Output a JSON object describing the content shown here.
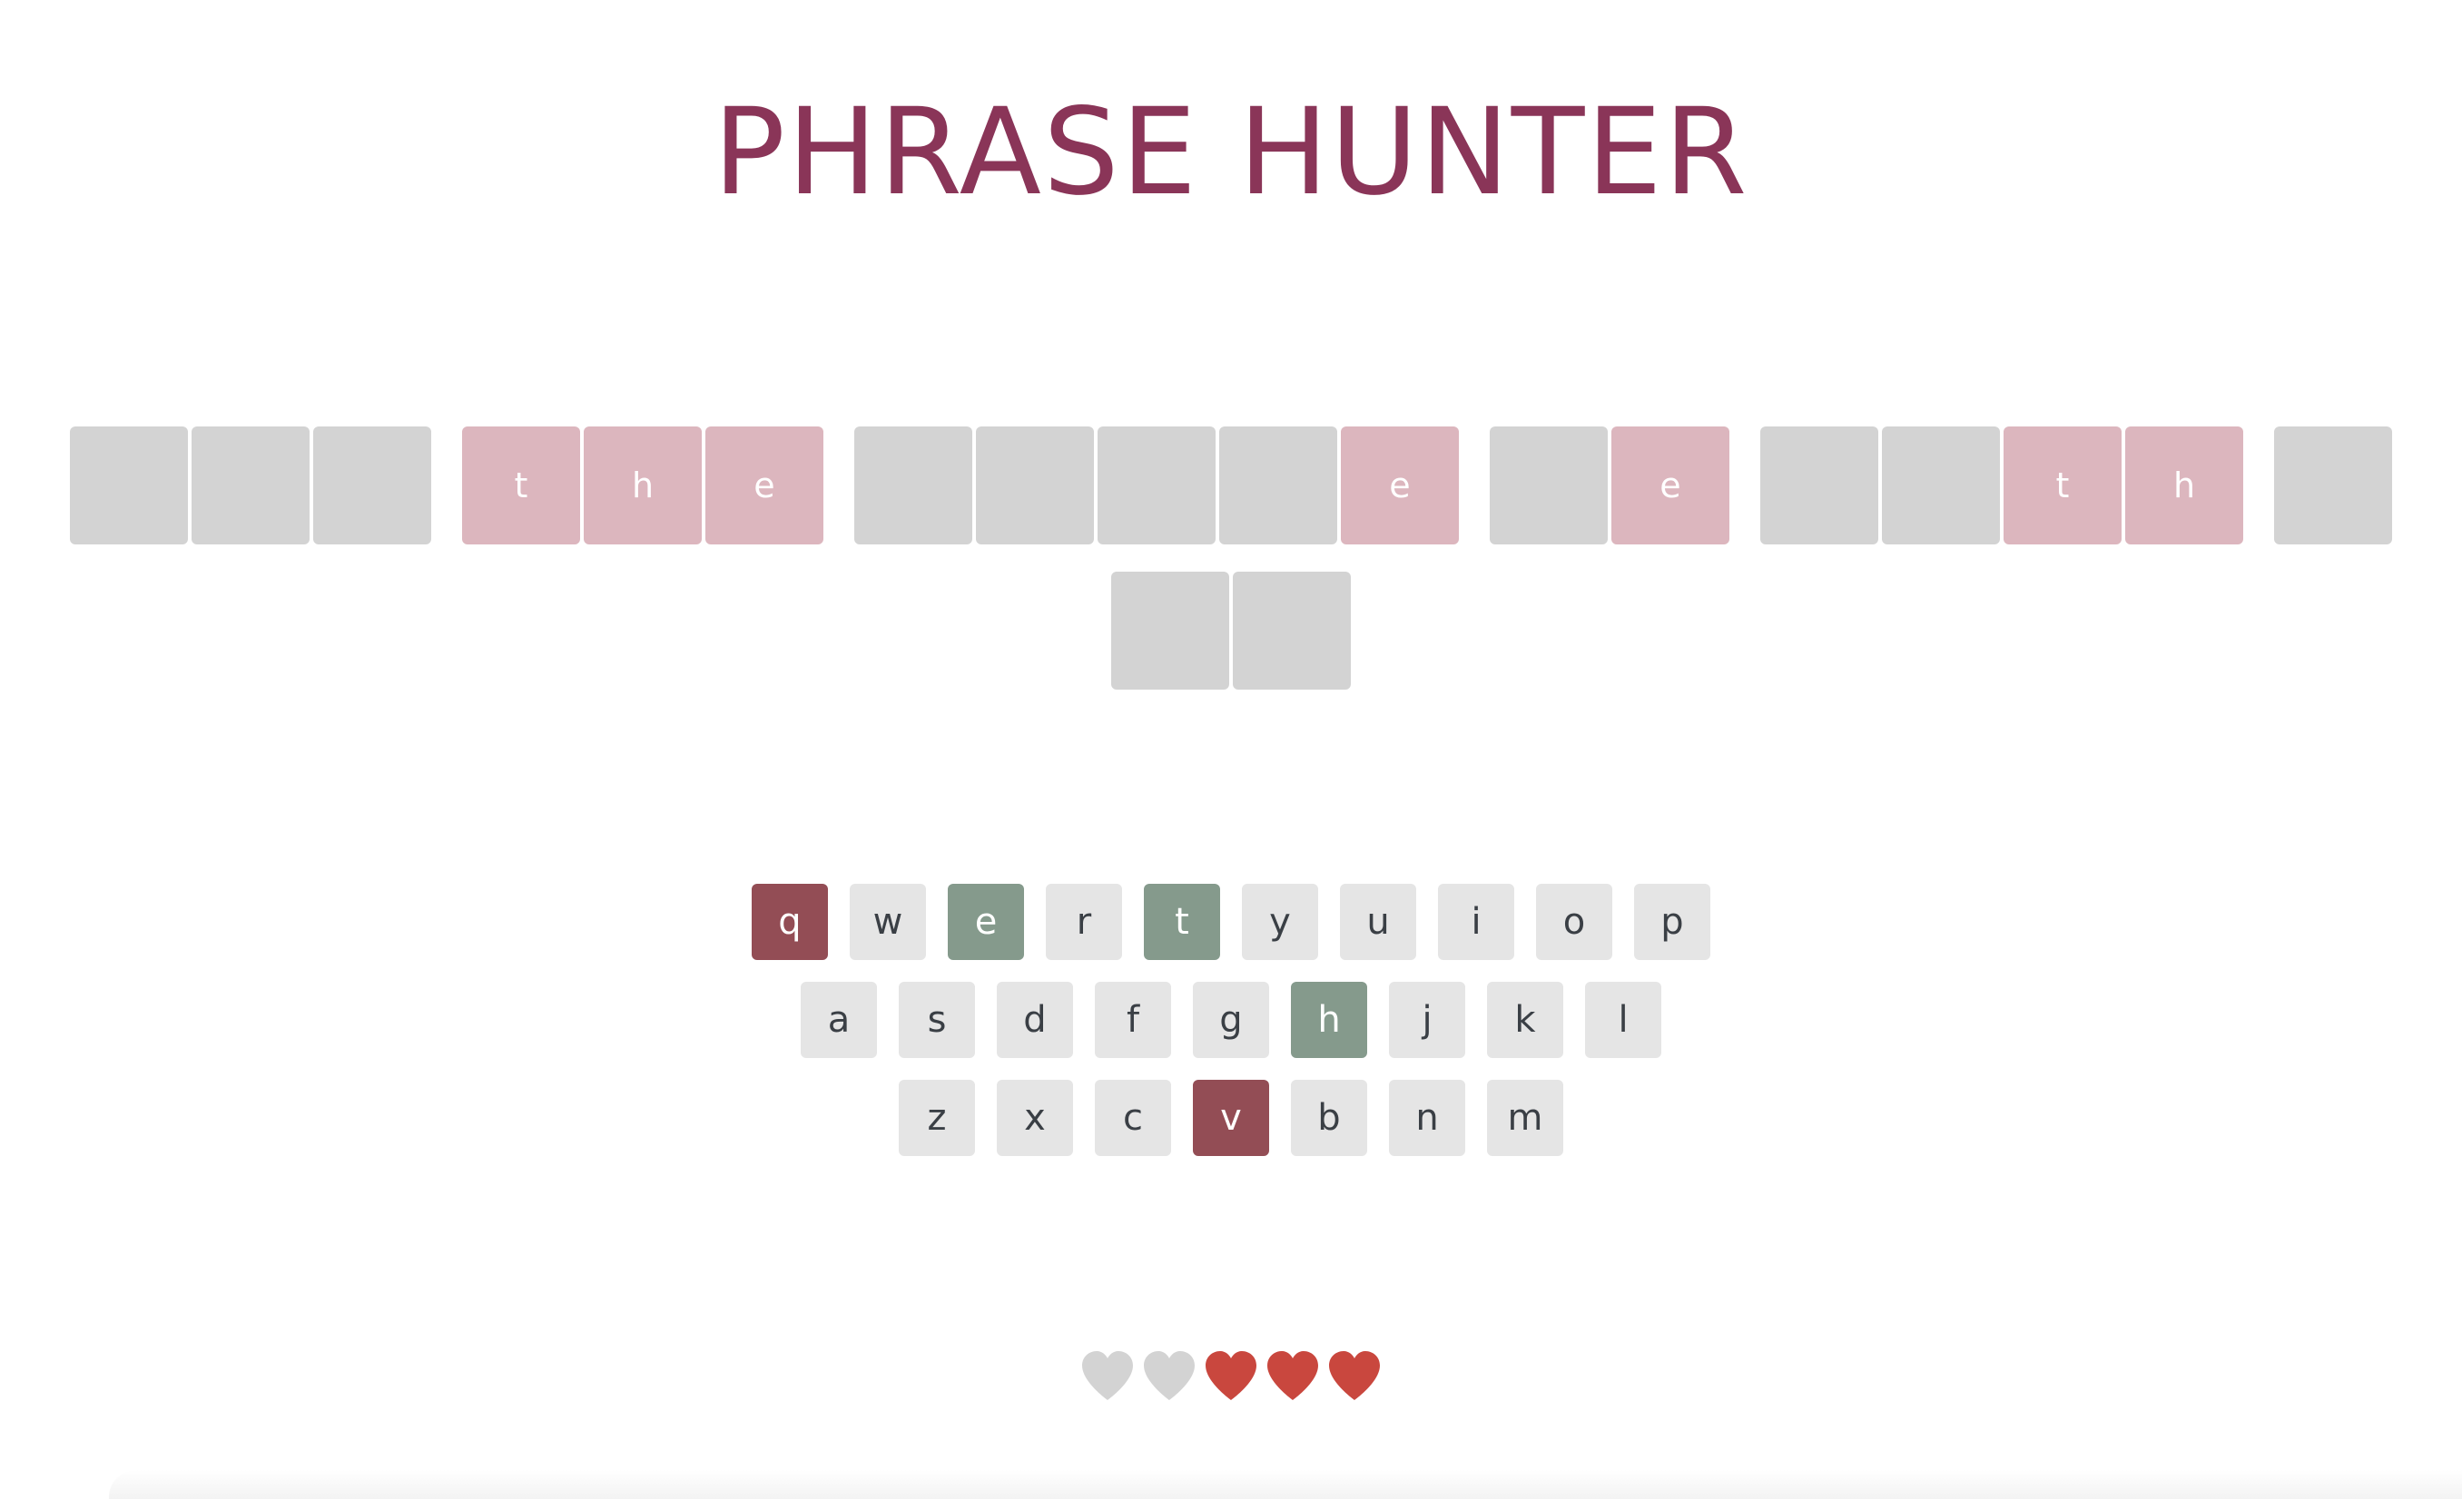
{
  "title": "PHRASE HUNTER",
  "colors": {
    "title": "#8a3558",
    "hidden_tile": "#d3d3d3",
    "shown_tile": "#dcb6be",
    "key_default": "#e5e5e5",
    "key_chosen": "#859a8c",
    "key_wrong": "#934d55",
    "heart_live": "#c9473e",
    "heart_lost": "#d3d3d3"
  },
  "phrase": {
    "rows": [
      [
        [
          {
            "letter": "",
            "shown": false
          },
          {
            "letter": "",
            "shown": false
          },
          {
            "letter": "",
            "shown": false
          }
        ],
        [
          {
            "letter": "t",
            "shown": true
          },
          {
            "letter": "h",
            "shown": true
          },
          {
            "letter": "e",
            "shown": true
          }
        ],
        [
          {
            "letter": "",
            "shown": false
          },
          {
            "letter": "",
            "shown": false
          },
          {
            "letter": "",
            "shown": false
          },
          {
            "letter": "",
            "shown": false
          },
          {
            "letter": "e",
            "shown": true
          }
        ],
        [
          {
            "letter": "",
            "shown": false
          },
          {
            "letter": "e",
            "shown": true
          }
        ],
        [
          {
            "letter": "",
            "shown": false
          },
          {
            "letter": "",
            "shown": false
          },
          {
            "letter": "t",
            "shown": true
          },
          {
            "letter": "h",
            "shown": true
          }
        ],
        [
          {
            "letter": "",
            "shown": false
          }
        ]
      ],
      [
        [
          {
            "letter": "",
            "shown": false
          },
          {
            "letter": "",
            "shown": false
          }
        ]
      ]
    ]
  },
  "keyboard": {
    "rows": [
      [
        {
          "label": "q",
          "state": "wrong"
        },
        {
          "label": "w",
          "state": "default"
        },
        {
          "label": "e",
          "state": "chosen"
        },
        {
          "label": "r",
          "state": "default"
        },
        {
          "label": "t",
          "state": "chosen"
        },
        {
          "label": "y",
          "state": "default"
        },
        {
          "label": "u",
          "state": "default"
        },
        {
          "label": "i",
          "state": "default"
        },
        {
          "label": "o",
          "state": "default"
        },
        {
          "label": "p",
          "state": "default"
        }
      ],
      [
        {
          "label": "a",
          "state": "default"
        },
        {
          "label": "s",
          "state": "default"
        },
        {
          "label": "d",
          "state": "default"
        },
        {
          "label": "f",
          "state": "default"
        },
        {
          "label": "g",
          "state": "default"
        },
        {
          "label": "h",
          "state": "chosen"
        },
        {
          "label": "j",
          "state": "default"
        },
        {
          "label": "k",
          "state": "default"
        },
        {
          "label": "l",
          "state": "default"
        }
      ],
      [
        {
          "label": "z",
          "state": "default"
        },
        {
          "label": "x",
          "state": "default"
        },
        {
          "label": "c",
          "state": "default"
        },
        {
          "label": "v",
          "state": "wrong"
        },
        {
          "label": "b",
          "state": "default"
        },
        {
          "label": "n",
          "state": "default"
        },
        {
          "label": "m",
          "state": "default"
        }
      ]
    ]
  },
  "lives": {
    "total": 5,
    "remaining": 3,
    "icon": "heart-icon"
  }
}
